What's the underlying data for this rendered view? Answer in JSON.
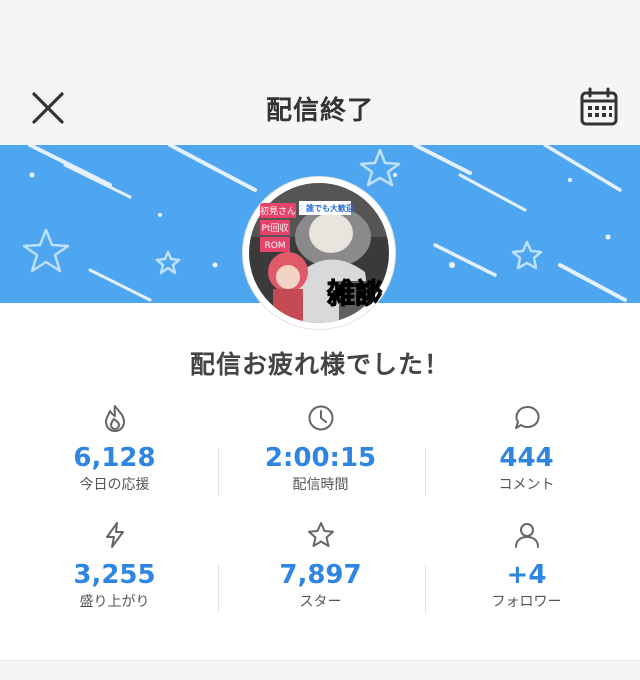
{
  "header": {
    "title": "配信終了"
  },
  "avatar": {
    "badges": [
      "初見さん",
      "Pt回収",
      "ROM"
    ],
    "top_banner": "♡ 誰でも大歓迎",
    "caption": "雑談"
  },
  "message": "配信お疲れ様でした！",
  "stats": [
    {
      "icon": "flame-icon",
      "value": "6,128",
      "label": "今日の応援"
    },
    {
      "icon": "clock-icon",
      "value": "2:00:15",
      "label": "配信時間"
    },
    {
      "icon": "comment-icon",
      "value": "444",
      "label": "コメント"
    },
    {
      "icon": "lightning-icon",
      "value": "3,255",
      "label": "盛り上がり"
    },
    {
      "icon": "star-icon",
      "value": "7,897",
      "label": "スター"
    },
    {
      "icon": "person-icon",
      "value": "+4",
      "label": "フォロワー"
    }
  ],
  "colors": {
    "accent": "#2f86e0",
    "banner": "#4da6ef",
    "background": "#f5f5f7"
  }
}
